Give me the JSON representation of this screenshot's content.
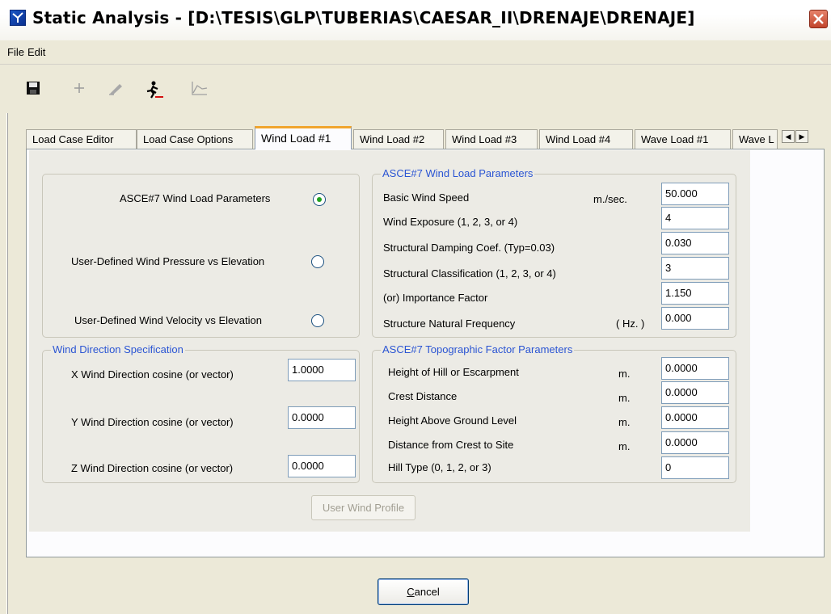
{
  "window": {
    "title": "Static Analysis - [D:\\TESIS\\GLP\\TUBERIAS\\CAESAR_II\\DRENAJE\\DRENAJE]"
  },
  "menu": {
    "file": "File",
    "edit": "Edit"
  },
  "toolbar": {
    "icons": [
      "save-icon",
      "add-icon",
      "edit-icon",
      "run-icon",
      "chart-icon"
    ]
  },
  "tabs": [
    {
      "label": "Load Case Editor"
    },
    {
      "label": "Load Case Options"
    },
    {
      "label": "Wind Load #1"
    },
    {
      "label": "Wind Load #2"
    },
    {
      "label": "Wind Load #3"
    },
    {
      "label": "Wind Load #4"
    },
    {
      "label": "Wave Load #1"
    },
    {
      "label": "Wave L"
    }
  ],
  "wind_method": {
    "asce": "ASCE#7 Wind Load Parameters",
    "pressure": "User-Defined Wind Pressure vs Elevation",
    "velocity": "User-Defined Wind Velocity vs Elevation"
  },
  "asce_params": {
    "title": "ASCE#7 Wind Load Parameters",
    "rows": [
      {
        "label": "Basic Wind Speed",
        "unit": "m./sec.",
        "value": "50.000"
      },
      {
        "label": "Wind Exposure  (1, 2, 3, or 4)",
        "unit": "",
        "value": "4"
      },
      {
        "label": "Structural Damping Coef.   (Typ=0.03)",
        "unit": "",
        "value": "0.030"
      },
      {
        "label": "Structural Classification  (1, 2, 3, or 4)",
        "unit": "",
        "value": "3"
      },
      {
        "label": "(or) Importance Factor",
        "unit": "",
        "value": "1.150"
      },
      {
        "label": "Structure Natural Frequency",
        "unit": "( Hz. )",
        "value": "0.000"
      }
    ]
  },
  "wind_direction": {
    "title": "Wind Direction Specification",
    "rows": [
      {
        "label": "X  Wind Direction cosine (or vector)",
        "value": "1.0000"
      },
      {
        "label": "Y  Wind Direction cosine (or vector)",
        "value": "0.0000"
      },
      {
        "label": "Z  Wind Direction cosine (or vector)",
        "value": "0.0000"
      }
    ]
  },
  "topo": {
    "title": "ASCE#7 Topographic Factor Parameters",
    "rows": [
      {
        "label": "Height of Hill or Escarpment",
        "unit": "m.",
        "value": "0.0000"
      },
      {
        "label": "Crest Distance",
        "unit": "m.",
        "value": "0.0000"
      },
      {
        "label": "Height Above Ground Level",
        "unit": "m.",
        "value": "0.0000"
      },
      {
        "label": "Distance from Crest to Site",
        "unit": "m.",
        "value": "0.0000"
      },
      {
        "label": "Hill Type   (0, 1, 2, or 3)",
        "unit": "",
        "value": "0"
      }
    ]
  },
  "buttons": {
    "user_wind_profile": "User Wind Profile",
    "cancel_prefix": "C",
    "cancel_rest": "ancel"
  }
}
